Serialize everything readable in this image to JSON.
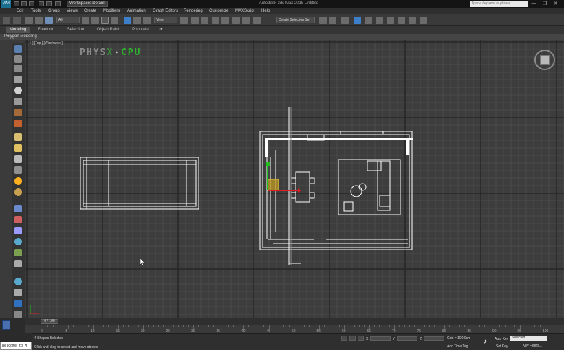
{
  "titlebar": {
    "logo": "MAX",
    "workspace": "Workspace: Default",
    "title": "Autodesk 3ds Max 2015    Untitled",
    "help_search_placeholder": "Type a keyword or phrase",
    "controls": [
      "—",
      "❐",
      "✕"
    ]
  },
  "menu": [
    "Edit",
    "Tools",
    "Group",
    "Views",
    "Create",
    "Modifiers",
    "Animation",
    "Graph Editors",
    "Rendering",
    "Customize",
    "MAXScript",
    "Help"
  ],
  "toolbar": {
    "filter_select": "All",
    "refcoord_select": "View",
    "named_selection": "Create Selection Se"
  },
  "ribbon": {
    "tabs": [
      "Modeling",
      "Freeform",
      "Selection",
      "Object Paint",
      "Populate"
    ],
    "active_tab": "Modeling",
    "sub_label": "Polygon Modeling"
  },
  "viewport": {
    "label": "[ + ] [Top ] [Wireframe ]",
    "physx": {
      "left": "PHYS",
      "x": "X",
      "arrow": "▸",
      "cpu": "CPU"
    }
  },
  "timeline": {
    "frame_display": "0 / 100",
    "ticks": [
      "0",
      "5",
      "10",
      "15",
      "20",
      "25",
      "30",
      "35",
      "40",
      "45",
      "50",
      "55",
      "60",
      "65",
      "70",
      "75",
      "80",
      "85",
      "90",
      "95",
      "100"
    ]
  },
  "status": {
    "selection": "4 Shapes Selected",
    "prompt": "Click and drag to select and move objects",
    "x_label": "X:",
    "y_label": "Y:",
    "z_label": "Z:",
    "grid": "Grid = 100,0cm",
    "add_time_tag": "Add Time Tag",
    "auto_key": "Auto Key",
    "set_key": "Set Key",
    "selected_dropdown": "Selected",
    "key_filters": "Key Filters..."
  },
  "listener": {
    "text": "Welcome to M"
  },
  "colors": {
    "viewport_bg": "#3d3d3d",
    "grid_minor": "#4a4a4a",
    "grid_major": "#262626",
    "wireframe": "#ffffff",
    "selection_yellow": "#c8a020",
    "axis_red": "#e02020",
    "axis_green": "#20c020",
    "physx_green": "#2db32d"
  }
}
